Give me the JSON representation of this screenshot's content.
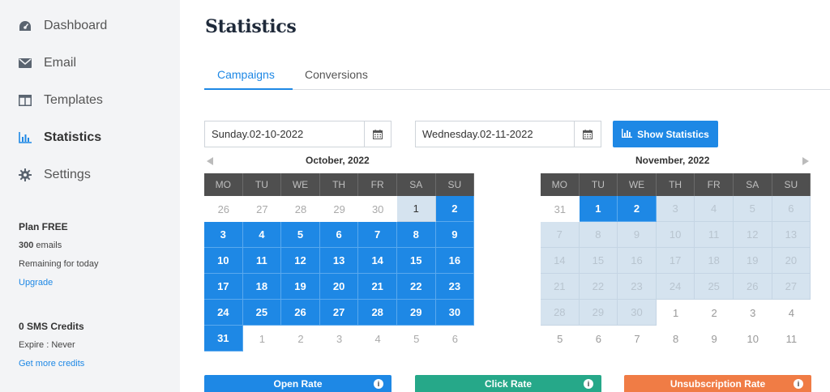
{
  "sidebar": {
    "nav": [
      {
        "label": "Dashboard",
        "icon": "dashboard-icon"
      },
      {
        "label": "Email",
        "icon": "envelope-icon"
      },
      {
        "label": "Templates",
        "icon": "templates-icon"
      },
      {
        "label": "Statistics",
        "icon": "bar-chart-icon",
        "active": true
      },
      {
        "label": "Settings",
        "icon": "gear-icon"
      }
    ],
    "plan_title": "Plan FREE",
    "emails_count": "300",
    "emails_unit": " emails",
    "remaining": "Remaining for today",
    "upgrade": "Upgrade",
    "sms_title": "0 SMS Credits",
    "expire": "Expire : Never",
    "get_credits": "Get more credits"
  },
  "main": {
    "title": "Statistics",
    "tabs": [
      {
        "label": "Campaigns",
        "active": true
      },
      {
        "label": "Conversions",
        "active": false
      }
    ],
    "start_date": "Sunday.02-10-2022",
    "end_date": "Wednesday.02-11-2022",
    "show_button": "Show Statistics",
    "weekdays": [
      "MO",
      "TU",
      "WE",
      "TH",
      "FR",
      "SA",
      "SU"
    ],
    "calendars": [
      {
        "title": "October, 2022",
        "days": [
          [
            "26",
            "other"
          ],
          [
            "27",
            "other"
          ],
          [
            "28",
            "other"
          ],
          [
            "29",
            "other"
          ],
          [
            "30",
            "other"
          ],
          [
            "1",
            "light"
          ],
          [
            "2",
            "sel"
          ],
          [
            "3",
            "sel"
          ],
          [
            "4",
            "sel"
          ],
          [
            "5",
            "sel"
          ],
          [
            "6",
            "sel"
          ],
          [
            "7",
            "sel"
          ],
          [
            "8",
            "sel"
          ],
          [
            "9",
            "sel"
          ],
          [
            "10",
            "sel"
          ],
          [
            "11",
            "sel"
          ],
          [
            "12",
            "sel"
          ],
          [
            "13",
            "sel"
          ],
          [
            "14",
            "sel"
          ],
          [
            "15",
            "sel"
          ],
          [
            "16",
            "sel"
          ],
          [
            "17",
            "sel"
          ],
          [
            "18",
            "sel"
          ],
          [
            "19",
            "sel"
          ],
          [
            "20",
            "sel"
          ],
          [
            "21",
            "sel"
          ],
          [
            "22",
            "sel"
          ],
          [
            "23",
            "sel"
          ],
          [
            "24",
            "sel"
          ],
          [
            "25",
            "sel"
          ],
          [
            "26",
            "sel"
          ],
          [
            "27",
            "sel"
          ],
          [
            "28",
            "sel"
          ],
          [
            "29",
            "sel"
          ],
          [
            "30",
            "sel"
          ],
          [
            "31",
            "sel"
          ],
          [
            "1",
            "other"
          ],
          [
            "2",
            "other"
          ],
          [
            "3",
            "other"
          ],
          [
            "4",
            "other"
          ],
          [
            "5",
            "other"
          ],
          [
            "6",
            "other"
          ]
        ]
      },
      {
        "title": "November, 2022",
        "days": [
          [
            "31",
            "other"
          ],
          [
            "1",
            "sel"
          ],
          [
            "2",
            "sel"
          ],
          [
            "3",
            "range"
          ],
          [
            "4",
            "range"
          ],
          [
            "5",
            "range"
          ],
          [
            "6",
            "range"
          ],
          [
            "7",
            "range"
          ],
          [
            "8",
            "range"
          ],
          [
            "9",
            "range"
          ],
          [
            "10",
            "range"
          ],
          [
            "11",
            "range"
          ],
          [
            "12",
            "range"
          ],
          [
            "13",
            "range"
          ],
          [
            "14",
            "range"
          ],
          [
            "15",
            "range"
          ],
          [
            "16",
            "range"
          ],
          [
            "17",
            "range"
          ],
          [
            "18",
            "range"
          ],
          [
            "19",
            "range"
          ],
          [
            "20",
            "range"
          ],
          [
            "21",
            "range"
          ],
          [
            "22",
            "range"
          ],
          [
            "23",
            "range"
          ],
          [
            "24",
            "range"
          ],
          [
            "25",
            "range"
          ],
          [
            "26",
            "range"
          ],
          [
            "27",
            "range"
          ],
          [
            "28",
            "range"
          ],
          [
            "29",
            "range"
          ],
          [
            "30",
            "range"
          ],
          [
            "1",
            "plain"
          ],
          [
            "2",
            "plain"
          ],
          [
            "3",
            "plain"
          ],
          [
            "4",
            "plain"
          ],
          [
            "5",
            "plain"
          ],
          [
            "6",
            "plain"
          ],
          [
            "7",
            "plain"
          ],
          [
            "8",
            "plain"
          ],
          [
            "9",
            "plain"
          ],
          [
            "10",
            "plain"
          ],
          [
            "11",
            "plain"
          ]
        ]
      }
    ],
    "rate_cards": [
      {
        "label": "Open Rate",
        "color": "#1e88e5",
        "icon": "info-icon"
      },
      {
        "label": "Click Rate",
        "color": "#26a889",
        "icon": "info-icon"
      },
      {
        "label": "Unsubscription Rate",
        "color": "#f07c45",
        "icon": "info-icon"
      }
    ],
    "colors": {
      "accent": "#1e88e5",
      "sidebar_bg": "#f3f4f6",
      "calendar_header": "#4f4f4f"
    }
  }
}
